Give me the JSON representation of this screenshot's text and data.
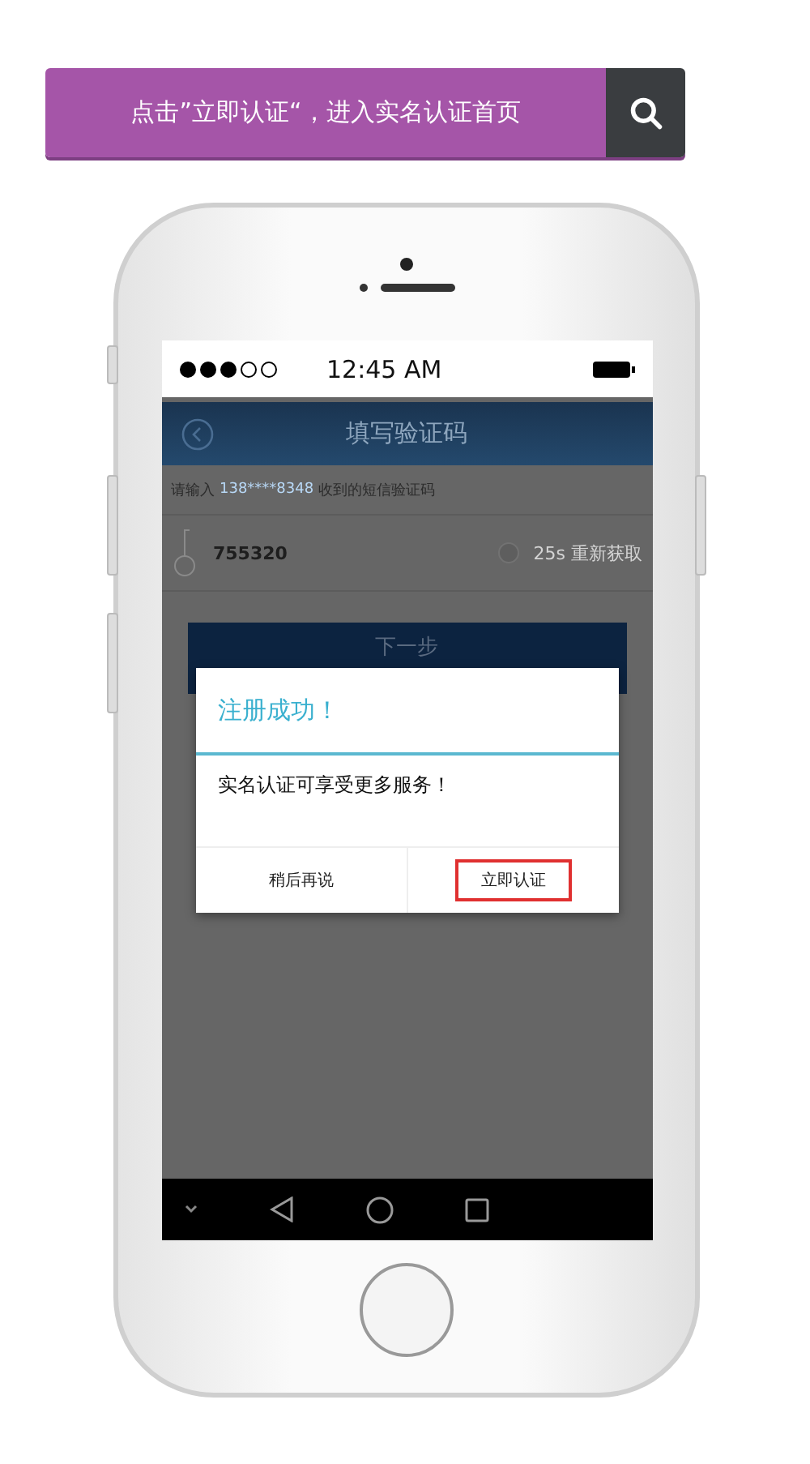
{
  "banner": {
    "text": "点击”立即认证“，进入实名认证首页"
  },
  "status_bar": {
    "time": "12:45 AM"
  },
  "app_bar": {
    "title": "填写验证码"
  },
  "prompt": {
    "prefix": "请输入",
    "phone": "138****8348",
    "suffix": "收到的短信验证码"
  },
  "code_field": {
    "value": "755320",
    "resend": "25s 重新获取"
  },
  "next_button": {
    "label": "下一步"
  },
  "dialog": {
    "title": "注册成功！",
    "message": "实名认证可享受更多服务！",
    "buttons": [
      {
        "label": "稍后再说",
        "highlighted": false
      },
      {
        "label": "立即认证",
        "highlighted": true
      }
    ]
  }
}
